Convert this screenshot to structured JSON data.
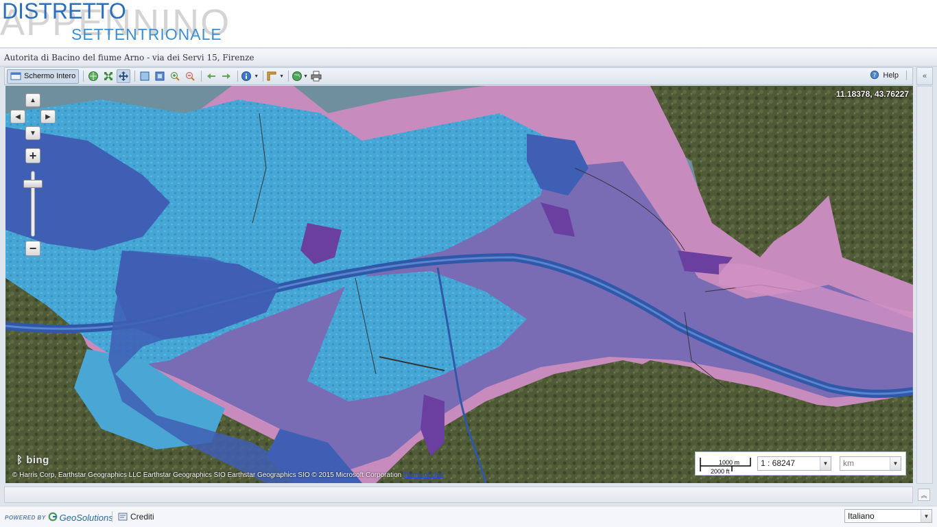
{
  "header": {
    "logo_background_text": "APPENNINO",
    "logo_main_text": "DISTRETTO",
    "logo_sub_text": "SETTENTRIONALE"
  },
  "titlebar": {
    "title": "Autorita di Bacino del fiume Arno - via dei Servi 15, Firenze"
  },
  "toolbar": {
    "fullscreen_label": "Schermo Intero",
    "help_label": "Help",
    "icons": [
      "layers-icon",
      "zoom-to-max-extent-icon",
      "pan-icon",
      "zoom-box-icon",
      "zoom-box-out-icon",
      "zoom-in-icon",
      "zoom-out-icon",
      "previous-view-icon",
      "next-view-icon",
      "info-icon",
      "measure-icon",
      "globe-icon",
      "print-icon"
    ]
  },
  "map": {
    "coordinates": "11.18378, 43.76227",
    "attribution": "© Harris Corp, Earthstar Geographics LLC Earthstar Geographics SIO Earthstar Geographics SIO © 2015 Microsoft Corporation",
    "terms_link": "Terms of Use",
    "bing_label": "bing",
    "scale_top": "1000 m",
    "scale_bottom": "2000 ft",
    "scale_value": "1 : 68247",
    "unit_value": "km",
    "zoom_level_fraction": 0.15
  },
  "colors": {
    "flood_light_blue": "#4aa6d4",
    "flood_medium_blue": "#5b7fc9",
    "flood_dark_blue": "#3f5fb4",
    "flood_purple": "#7a6bb5",
    "flood_pink": "#d291c4",
    "river": "#2f58a8",
    "brand_blue": "#2b6dbd"
  },
  "footer": {
    "powered_by": "POWERED BY",
    "geosolutions": "GeoSolutions",
    "crediti": "Crediti",
    "language": "Italiano"
  }
}
